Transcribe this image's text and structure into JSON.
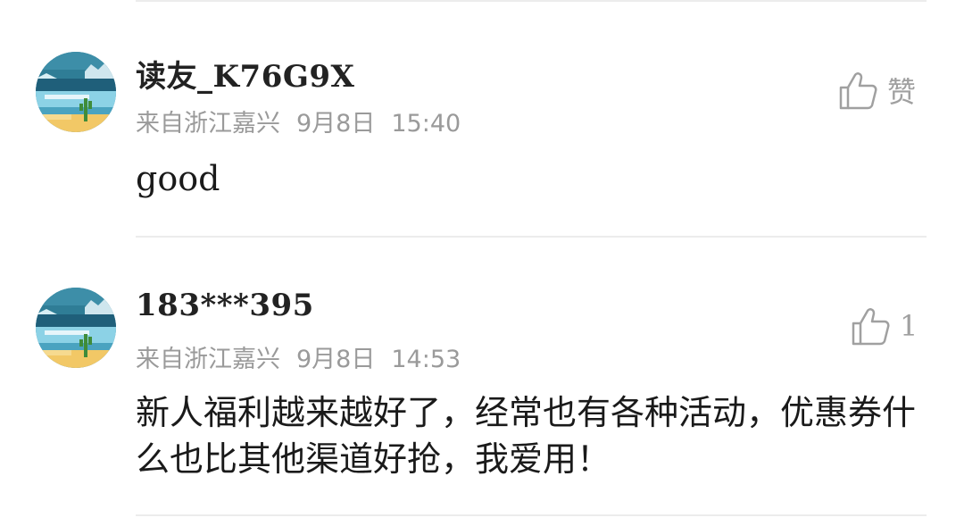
{
  "comments": [
    {
      "username": "读友_K76G9X",
      "location": "来自浙江嘉兴",
      "date": "9月8日",
      "time": "15:40",
      "text": "good",
      "like_label": "赞",
      "avatar_icon": "desert-cactus-avatar-icon",
      "like_icon": "thumbs-up-icon"
    },
    {
      "username": "183***395",
      "location": "来自浙江嘉兴",
      "date": "9月8日",
      "time": "14:53",
      "text": "新人福利越来越好了，经常也有各种活动，优惠券什么也比其他渠道好抢，我爱用！",
      "like_label": "1",
      "avatar_icon": "desert-cactus-avatar-icon",
      "like_icon": "thumbs-up-icon"
    }
  ],
  "colors": {
    "username": "#222222",
    "meta": "#9a9a9a",
    "body": "#1a1a1a",
    "like": "#a0a0a0",
    "divider": "#ececec"
  }
}
